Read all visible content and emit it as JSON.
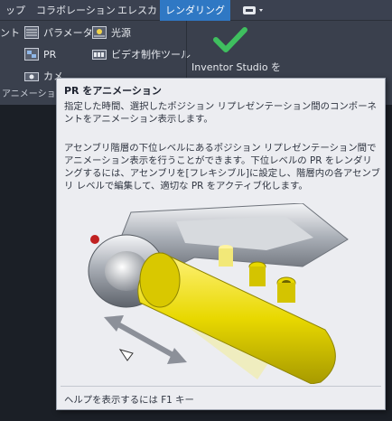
{
  "tabs": [
    {
      "label": "ップ",
      "active": false
    },
    {
      "label": "コラボレーション",
      "active": false
    },
    {
      "label": "エレスカ",
      "active": false
    },
    {
      "label": "レンダリング",
      "active": true
    }
  ],
  "ribbon": {
    "left_partial": "ント",
    "parameter": "パラメータ",
    "light": "光源",
    "pr": "PR",
    "video": "ビデオ制作ツール",
    "camera_partial": "カメ",
    "group_label": "アニメーション",
    "inventor_studio": "Inventor Studio を"
  },
  "tooltip": {
    "title": "PR をアニメーション",
    "description": "指定した時間、選択したポジション リプレゼンテーション間のコンポーネントをアニメーション表示します。",
    "body": "アセンブリ階層の下位レベルにあるポジション リプレゼンテーション間でアニメーション表示を行うことができます。下位レベルの PR をレンダリングするには、アセンブリを[フレキシブル]に設定し、階層内の各アセンブリ レベルで編集して、適切な PR をアクティブ化します。",
    "help": "ヘルプを表示するには F1 キー"
  },
  "colors": {
    "active_tab": "#2f78c4",
    "check": "#3fbf5f",
    "cylinder": "#e8d800"
  }
}
